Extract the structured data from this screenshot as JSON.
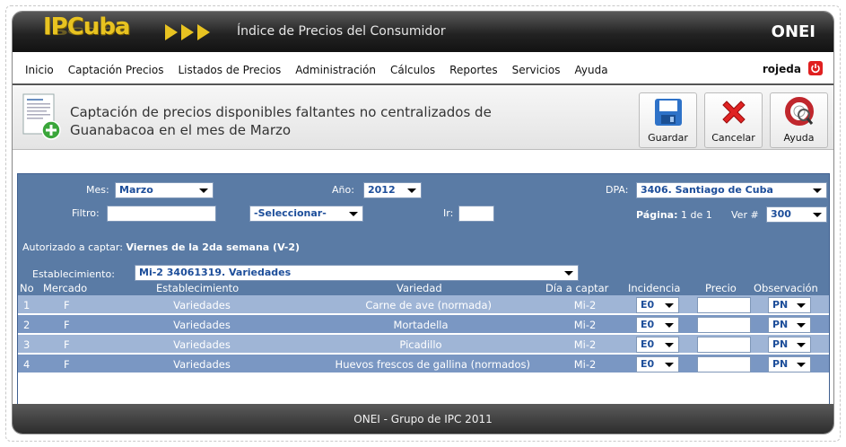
{
  "banner": {
    "logo": "IPCuba",
    "title": "Índice de Precios del Consumidor",
    "org": "ONEI"
  },
  "menu": {
    "items": [
      "Inicio",
      "Captación Precios",
      "Listados de Precios",
      "Administración",
      "Cálculos",
      "Reportes",
      "Servicios",
      "Ayuda"
    ],
    "user": "rojeda"
  },
  "header": {
    "title": "Captación de precios disponibles faltantes no centralizados de Guanabacoa en el mes de Marzo",
    "save_label": "Guardar",
    "cancel_label": "Cancelar",
    "help_label": "Ayuda"
  },
  "filters": {
    "mes_label": "Mes:",
    "mes_value": "Marzo",
    "anio_label": "Año:",
    "anio_value": "2012",
    "dpa_label": "DPA:",
    "dpa_value": "3406. Santiago de Cuba",
    "filtro_label": "Filtro:",
    "seleccionar_value": "-Seleccionar-",
    "ir_label": "Ir:",
    "pagina_label": "Página:",
    "pagina_text": "1 de 1",
    "ver_label": "Ver #",
    "ver_value": "300",
    "autorizado_label": "Autorizado a captar:",
    "autorizado_value": "Viernes de la 2da semana (V-2)",
    "establecimiento_label": "Establecimiento:",
    "establecimiento_value": "Mi-2  34061319. Variedades"
  },
  "table": {
    "headers": [
      "No",
      "Mercado",
      "Establecimiento",
      "Variedad",
      "Día a captar",
      "Incidencia",
      "Precio",
      "Observación"
    ],
    "rows": [
      {
        "no": "1",
        "mercado": "F",
        "establecimiento": "Variedades",
        "variedad": "Carne de ave (normada)",
        "dia": "Mi-2",
        "incidencia": "E0",
        "precio": "",
        "observacion": "PN"
      },
      {
        "no": "2",
        "mercado": "F",
        "establecimiento": "Variedades",
        "variedad": "Mortadella",
        "dia": "Mi-2",
        "incidencia": "E0",
        "precio": "",
        "observacion": "PN"
      },
      {
        "no": "3",
        "mercado": "F",
        "establecimiento": "Variedades",
        "variedad": "Picadillo",
        "dia": "Mi-2",
        "incidencia": "E0",
        "precio": "",
        "observacion": "PN"
      },
      {
        "no": "4",
        "mercado": "F",
        "establecimiento": "Variedades",
        "variedad": "Huevos frescos de gallina (normados)",
        "dia": "Mi-2",
        "incidencia": "E0",
        "precio": "",
        "observacion": "PN"
      }
    ]
  },
  "footer": {
    "text": "ONEI - Grupo de IPC 2011"
  }
}
